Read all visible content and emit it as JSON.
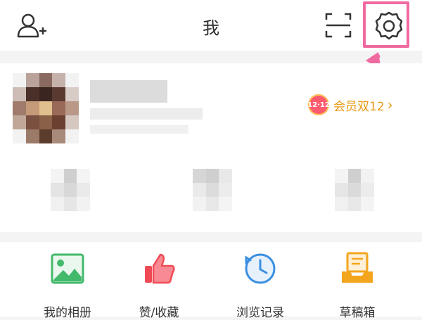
{
  "header": {
    "title": "我",
    "add_friend_icon": "add-friend-icon",
    "scan_icon": "scan-icon",
    "settings_icon": "settings-gear-icon"
  },
  "annotation": {
    "highlight_color": "#f06aa0"
  },
  "profile": {
    "member_badge": "12·12",
    "member_text": "会员双12",
    "member_color": "#e89a17"
  },
  "quick_actions": [
    {
      "label": "我的相册",
      "icon": "photo-album-icon",
      "color": "#43b96c"
    },
    {
      "label": "赞/收藏",
      "icon": "thumbs-up-icon",
      "color": "#f04b55"
    },
    {
      "label": "浏览记录",
      "icon": "history-clock-icon",
      "color": "#3b8fe0"
    },
    {
      "label": "草稿箱",
      "icon": "drafts-tray-icon",
      "color": "#f3a51d"
    }
  ]
}
